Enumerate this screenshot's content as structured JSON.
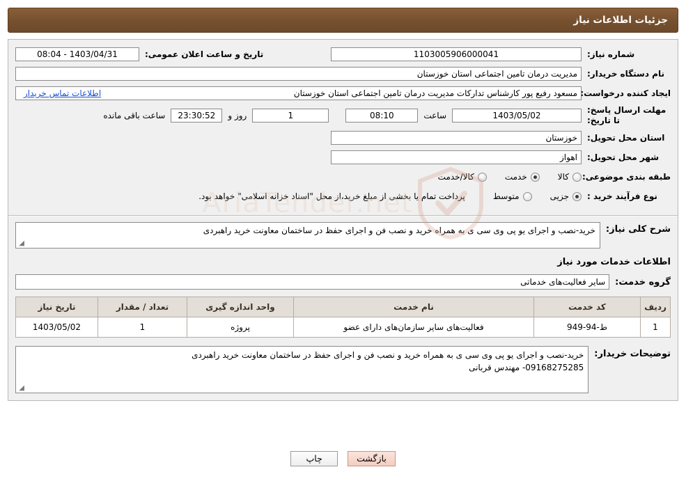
{
  "header": {
    "title": "جزئیات اطلاعات نیاز"
  },
  "watermark": {
    "text": "AriaTender.net",
    "icon": "shield-icon"
  },
  "form": {
    "need_number_label": "شماره نیاز:",
    "need_number_value": "1103005906000041",
    "public_announce_label": "تاریخ و ساعت اعلان عمومی:",
    "public_announce_value": "1403/04/31 - 08:04",
    "buyer_org_label": "نام دستگاه خریدار:",
    "buyer_org_value": "مدیریت درمان تامین اجتماعی استان خوزستان",
    "requester_label": "ایجاد کننده درخواست:",
    "requester_value": "مسعود رفیع پور کارشناس تدارکات مدیریت درمان تامین اجتماعی استان خوزستان",
    "contact_link": "اطلاعات تماس خریدار",
    "deadline_label": "مهلت ارسال پاسخ: تا تاریخ:",
    "deadline_date": "1403/05/02",
    "hour_label": "ساعت",
    "deadline_time": "08:10",
    "days_value": "1",
    "days_label": "روز و",
    "countdown_value": "23:30:52",
    "remaining_label": "ساعت باقی مانده",
    "province_label": "استان محل تحویل:",
    "province_value": "خوزستان",
    "city_label": "شهر محل تحویل:",
    "city_value": "اهواز",
    "category_label": "طبقه بندی موضوعی:",
    "category_options": [
      {
        "label": "کالا",
        "selected": false
      },
      {
        "label": "خدمت",
        "selected": true
      },
      {
        "label": "کالا/خدمت",
        "selected": false
      }
    ],
    "process_label": "نوع فرآیند خرید :",
    "process_options": [
      {
        "label": "جزیی",
        "selected": true
      },
      {
        "label": "متوسط",
        "selected": false
      }
    ],
    "process_note": "پرداخت تمام یا بخشی از مبلغ خرید،از محل \"اسناد خزانه اسلامی\" خواهد بود."
  },
  "description": {
    "label": "شرح کلی نیاز:",
    "value": "خرید-نصب و اجرای یو پی وی سی ی به همراه خرید و نصب فن و اجرای حفظ در ساختمان معاونت خرید راهبردی"
  },
  "services_section": {
    "heading": "اطلاعات خدمات مورد نیاز",
    "group_label": "گروه خدمت:",
    "group_value": "سایر فعالیت‌های خدماتی",
    "table": {
      "columns": [
        "ردیف",
        "کد خدمت",
        "نام خدمت",
        "واحد اندازه گیری",
        "تعداد / مقدار",
        "تاریخ نیاز"
      ],
      "rows": [
        {
          "index": "1",
          "code": "ط-94-949",
          "name": "فعالیت‌های سایر سازمان‌های دارای عضو",
          "unit": "پروژه",
          "quantity": "1",
          "date": "1403/05/02"
        }
      ]
    }
  },
  "buyer_notes": {
    "label": "توضیحات خریدار:",
    "value": "خرید-نصب و اجرای یو پی وی سی ی به همراه خرید و نصب فن و اجرای حفظ در ساختمان معاونت خرید راهبردی\n09168275285- مهندس قربانی"
  },
  "footer": {
    "print_label": "چاپ",
    "back_label": "بازگشت"
  }
}
